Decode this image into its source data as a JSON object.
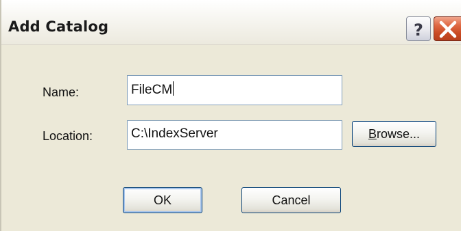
{
  "dialog": {
    "title": "Add Catalog",
    "help_glyph": "?",
    "close_icon": "close-icon"
  },
  "form": {
    "name_label": "Name:",
    "name_value": "FileCM",
    "location_label": "Location:",
    "location_value": "C:\\IndexServer",
    "browse_accel": "B",
    "browse_rest": "rowse..."
  },
  "buttons": {
    "ok_label": "OK",
    "cancel_label": "Cancel"
  },
  "colors": {
    "dialog_bg": "#ece9d8",
    "close_button": "#c94a22",
    "field_border": "#7f9db9",
    "button_border": "#003c74"
  }
}
